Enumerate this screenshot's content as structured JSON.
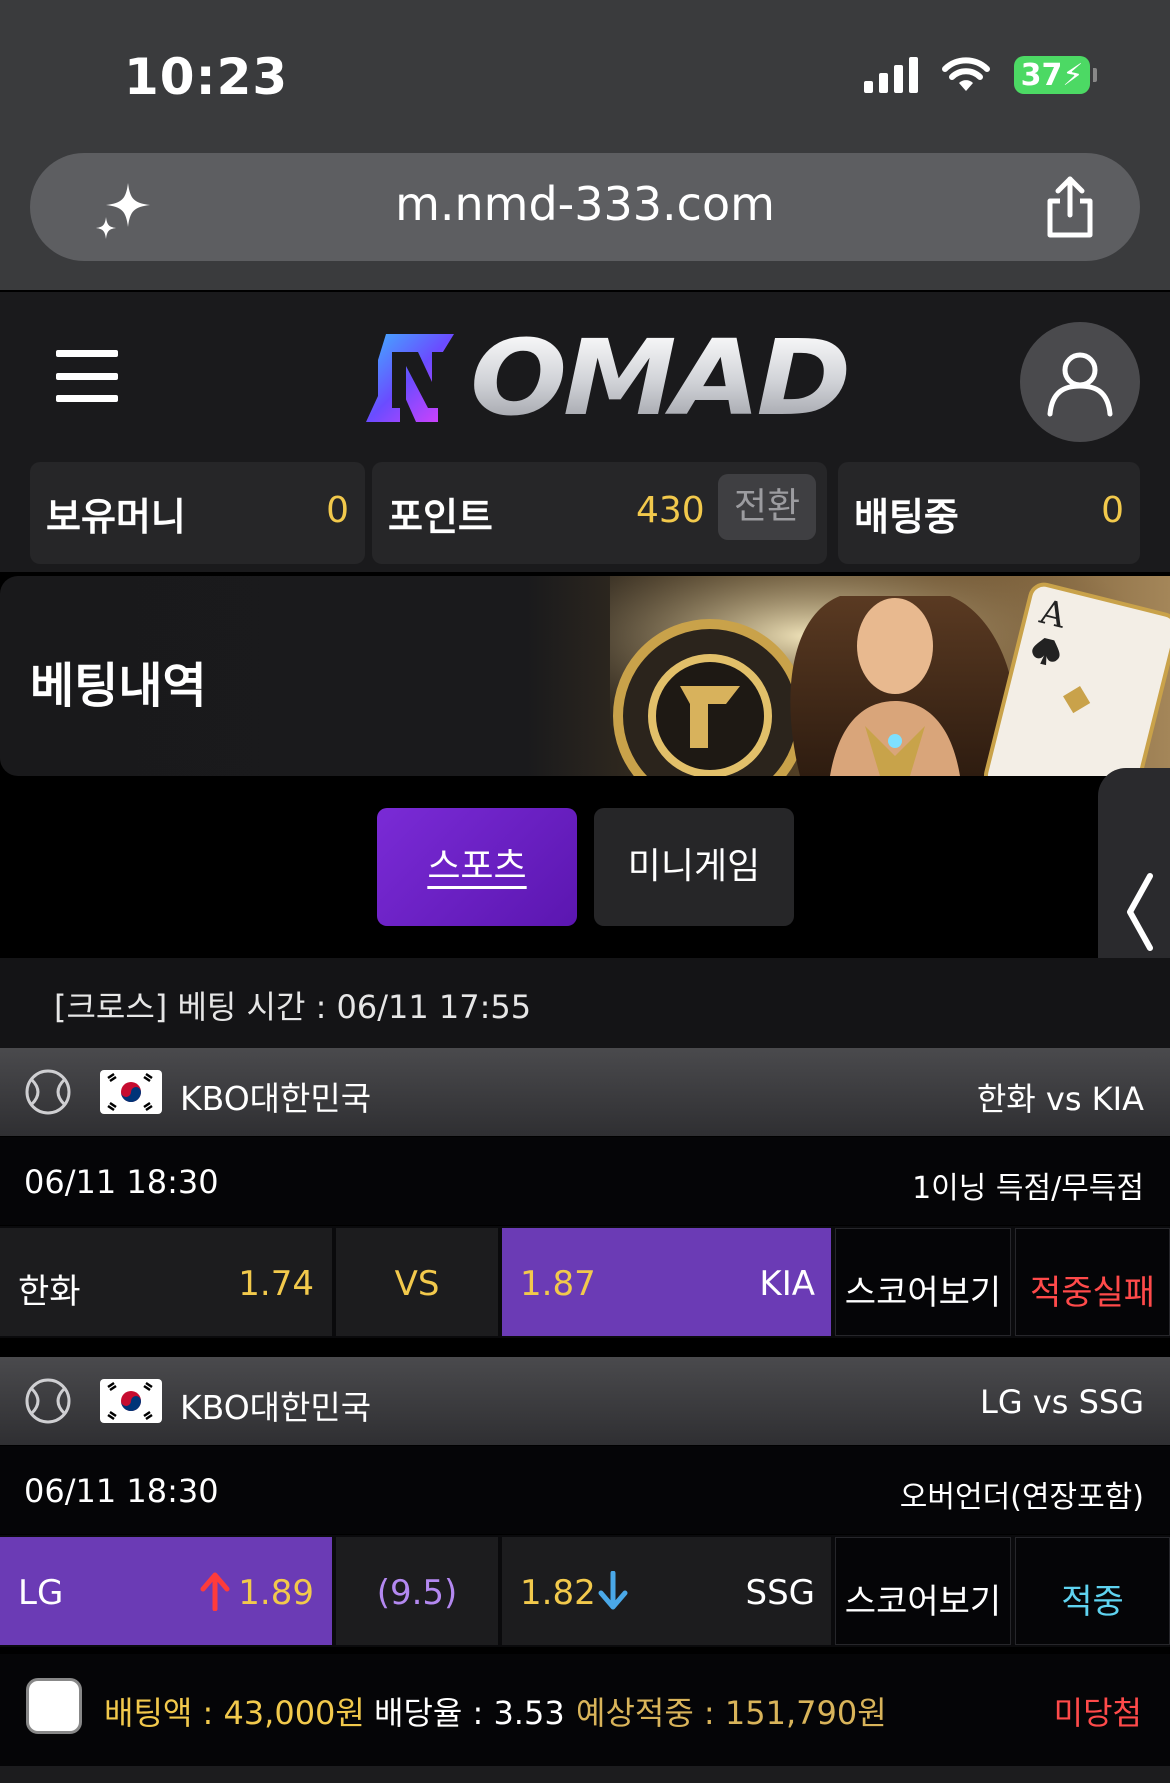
{
  "status": {
    "time": "10:23",
    "battery": "37"
  },
  "browser": {
    "url": "m.nmd-333.com"
  },
  "header": {
    "logo_text": "OMAD"
  },
  "balances": {
    "money_label": "보유머니",
    "money_value": "0",
    "point_label": "포인트",
    "point_value": "430",
    "convert_label": "전환",
    "betting_label": "배팅중",
    "betting_value": "0"
  },
  "banner": {
    "title": "베팅내역"
  },
  "tabs": [
    {
      "label": "스포츠"
    },
    {
      "label": "미니게임"
    }
  ],
  "bet": {
    "time_label": "[크로스] 베팅 시간 : 06/11 17:55",
    "matches": [
      {
        "league": "KBO대한민국",
        "teams": "한화 vs KIA",
        "date": "06/11 18:30",
        "market": "1이닝 득점/무득점",
        "home": "한화",
        "home_odds": "1.74",
        "mid": "VS",
        "away_odds": "1.87",
        "away": "KIA",
        "score_button": "스코어보기",
        "result": "적중실패"
      },
      {
        "league": "KBO대한민국",
        "teams": "LG vs SSG",
        "date": "06/11 18:30",
        "market": "오버언더(연장포함)",
        "home": "LG",
        "home_odds": "1.89",
        "mid": "(9.5)",
        "away_odds": "1.82",
        "away": "SSG",
        "score_button": "스코어보기",
        "result": "적중"
      }
    ],
    "summary": {
      "amount": "배팅액 : 43,000원",
      "rate": "배당율 : 3.53",
      "expected": "예상적중 : 151,790원",
      "status": "미당첨"
    }
  },
  "colors": {
    "accent": "#6b3bb5",
    "gold": "#f2c94c",
    "fail": "#ff4a4a",
    "win": "#5fd3f0"
  }
}
